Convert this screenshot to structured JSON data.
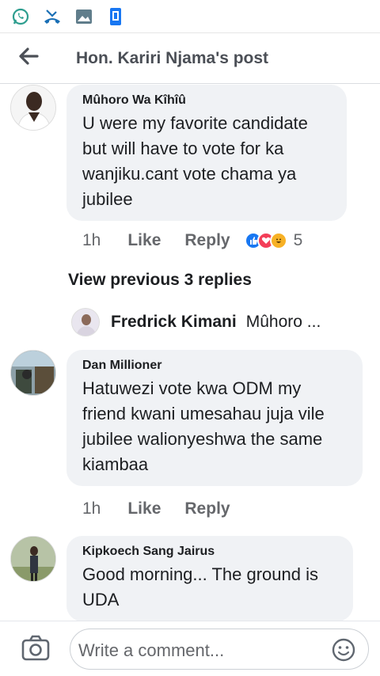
{
  "header": {
    "title": "Hon. Kariri Njama's post"
  },
  "comments": [
    {
      "author": "Mûhoro Wa Kîhîû",
      "lines": [
        "U were my favorite candidate",
        "but will have to vote for ka",
        "wanjiku.cant vote chama ya",
        "jubilee"
      ],
      "time": "1h",
      "like": "Like",
      "reply": "Reply",
      "reaction_count": "5"
    },
    {
      "author": "Dan Millioner",
      "lines": [
        "Hatuwezi vote kwa ODM my",
        "friend kwani umesahau juja vile",
        "jubilee walionyeshwa the same",
        "kiambaa"
      ],
      "time": "1h",
      "like": "Like",
      "reply": "Reply"
    },
    {
      "author": "Kipkoech Sang Jairus",
      "lines": [
        "Good morning... The ground is",
        "UDA"
      ]
    }
  ],
  "view_previous": "View previous 3 replies",
  "reply_preview": {
    "name": "Fredrick Kimani",
    "snippet": "Mûhoro ..."
  },
  "composer": {
    "placeholder": "Write a comment..."
  },
  "colors": {
    "like_blue": "#1877f2",
    "love_red": "#f33e58",
    "haha_yellow": "#f7b125",
    "whatsapp_green": "#25d366",
    "icon_blue": "#1877f2"
  },
  "icons": [
    "whatsapp-icon",
    "missed-call-icon",
    "gallery-icon",
    "phone-app-icon",
    "back-arrow-icon",
    "camera-icon",
    "emoji-icon"
  ]
}
